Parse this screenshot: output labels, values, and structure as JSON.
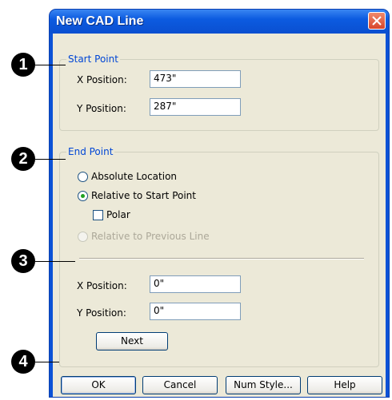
{
  "window": {
    "title": "New CAD Line"
  },
  "callouts": [
    "1",
    "2",
    "3",
    "4"
  ],
  "start_point": {
    "legend": "Start Point",
    "x_label": "X Position:",
    "x_value": "473\"",
    "y_label": "Y Position:",
    "y_value": "287\""
  },
  "end_point": {
    "legend": "End Point",
    "options": [
      {
        "label": "Absolute Location",
        "selected": false,
        "enabled": true
      },
      {
        "label": "Relative to Start Point",
        "selected": true,
        "enabled": true
      },
      {
        "label": "Relative to Previous Line",
        "selected": false,
        "enabled": false
      }
    ],
    "polar_label": "Polar",
    "polar_checked": false,
    "x_label": "X Position:",
    "x_value": "0\"",
    "y_label": "Y Position:",
    "y_value": "0\"",
    "next_label": "Next"
  },
  "buttons": {
    "ok": "OK",
    "cancel": "Cancel",
    "num_style": "Num Style...",
    "help": "Help"
  }
}
